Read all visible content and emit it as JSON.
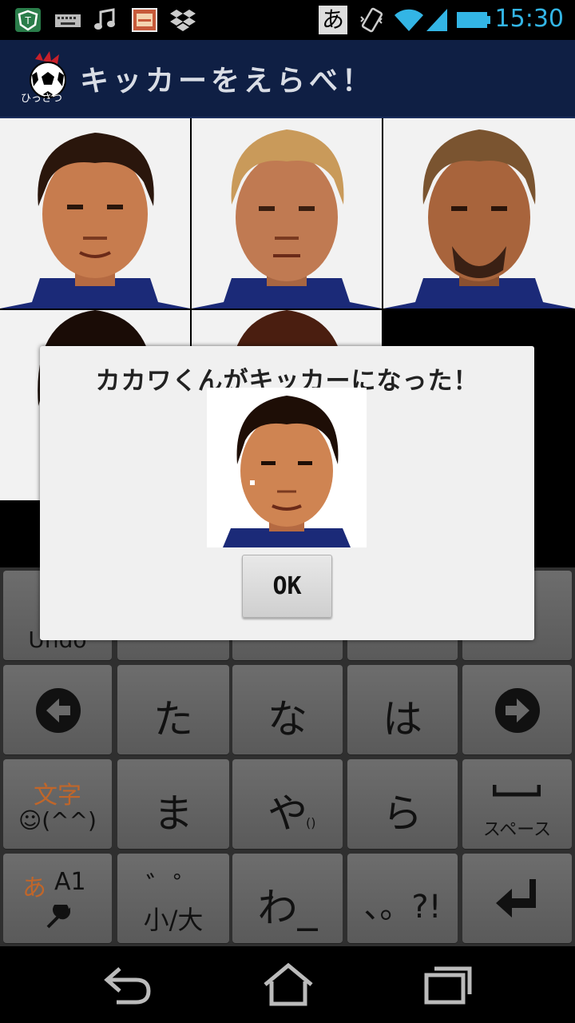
{
  "status_bar": {
    "time": "15:30",
    "ime_indicator": "あ",
    "icons": [
      "shield-app-icon",
      "keyboard-icon",
      "music-note-icon",
      "image-viewer-icon",
      "dropbox-icon",
      "vibrate-icon",
      "wifi-icon",
      "signal-icon",
      "battery-icon"
    ]
  },
  "app_bar": {
    "title": "キッカーをえらべ！",
    "logo_caption": "ひっさつ"
  },
  "player_grid": {
    "cells": [
      {
        "name": "player-1"
      },
      {
        "name": "player-2"
      },
      {
        "name": "player-3"
      },
      {
        "name": "player-4"
      },
      {
        "name": "player-5"
      }
    ]
  },
  "dialog": {
    "message": "カカワくんがキッカーになった！",
    "ok_label": "OK"
  },
  "keyboard": {
    "row1": {
      "undo": "Undo"
    },
    "row2": [
      "た",
      "な",
      "は"
    ],
    "row3": {
      "mode_top": "文字",
      "mode_bottom": "☺(^^)",
      "keys": [
        "ま",
        "や",
        "ら"
      ],
      "ya_sub": "()",
      "space_label": "スペース"
    },
    "row4": {
      "mode_kana": "あ",
      "mode_alpha": "A1",
      "dakuten_top": "゛゜",
      "dakuten_bottom": "小/大",
      "wa": "わ_",
      "punct": "、。?!"
    }
  },
  "colors": {
    "status_accent": "#33b5e5",
    "app_bar": "#0f1f44",
    "mode_label": "#c0662a"
  }
}
